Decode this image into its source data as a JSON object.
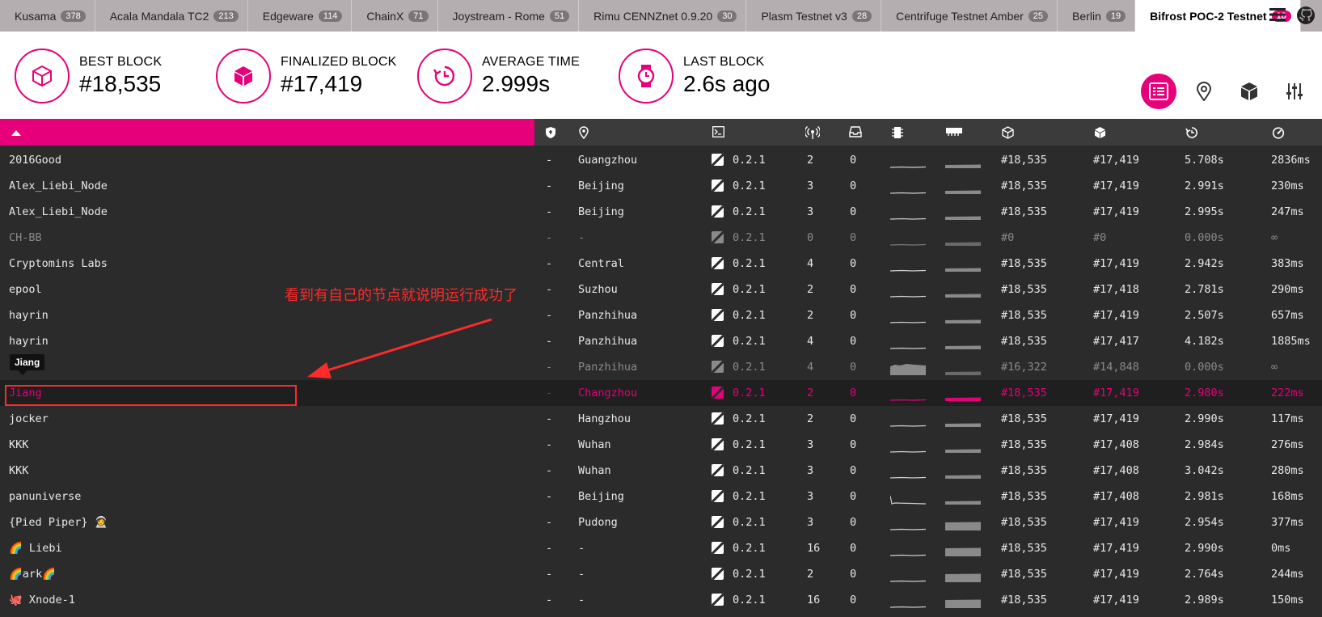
{
  "tabs": [
    {
      "name": "Kusama",
      "count": "378"
    },
    {
      "name": "Acala Mandala TC2",
      "count": "213"
    },
    {
      "name": "Edgeware",
      "count": "114"
    },
    {
      "name": "ChainX",
      "count": "71"
    },
    {
      "name": "Joystream - Rome",
      "count": "51"
    },
    {
      "name": "Rimu CENNZnet 0.9.20",
      "count": "30"
    },
    {
      "name": "Plasm Testnet v3",
      "count": "28"
    },
    {
      "name": "Centrifuge Testnet Amber",
      "count": "25"
    },
    {
      "name": "Berlin",
      "count": "19"
    },
    {
      "name": "Bifrost POC-2 Testnet",
      "count": "18"
    }
  ],
  "stats": {
    "best_block": {
      "label": "BEST BLOCK",
      "value": "#18,535"
    },
    "finalized_block": {
      "label": "FINALIZED BLOCK",
      "value": "#17,419"
    },
    "average_time": {
      "label": "AVERAGE TIME",
      "value": "2.999s"
    },
    "last_block": {
      "label": "LAST BLOCK",
      "value": "2.6s ago"
    }
  },
  "colors": {
    "accent": "#e6007a",
    "annotation": "#ff2a2a"
  },
  "icons": [
    "list-icon",
    "map-pin-icon",
    "cube-icon",
    "settings-sliders-icon",
    "menu-icon",
    "github-icon"
  ],
  "annotation": {
    "text": "看到有自己的节点就说明运行成功了",
    "tooltip": "Jiang"
  },
  "rows": [
    {
      "name": "2016Good",
      "validator": "-",
      "location": "Guangzhou",
      "version": "0.2.1",
      "peers": "2",
      "txs": "0",
      "best": "#18,535",
      "finalized": "#17,419",
      "time": "5.708s",
      "propagation": "2836ms",
      "state": "normal"
    },
    {
      "name": "Alex_Liebi_Node",
      "validator": "-",
      "location": "Beijing",
      "version": "0.2.1",
      "peers": "3",
      "txs": "0",
      "best": "#18,535",
      "finalized": "#17,419",
      "time": "2.991s",
      "propagation": "230ms",
      "state": "normal"
    },
    {
      "name": "Alex_Liebi_Node",
      "validator": "-",
      "location": "Beijing",
      "version": "0.2.1",
      "peers": "3",
      "txs": "0",
      "best": "#18,535",
      "finalized": "#17,419",
      "time": "2.995s",
      "propagation": "247ms",
      "state": "normal"
    },
    {
      "name": "CH-BB",
      "validator": "-",
      "location": "-",
      "version": "0.2.1",
      "peers": "0",
      "txs": "0",
      "best": "#0",
      "finalized": "#0",
      "time": "0.000s",
      "propagation": "∞",
      "state": "stale"
    },
    {
      "name": "Cryptomins Labs",
      "validator": "-",
      "location": "Central",
      "version": "0.2.1",
      "peers": "4",
      "txs": "0",
      "best": "#18,535",
      "finalized": "#17,419",
      "time": "2.942s",
      "propagation": "383ms",
      "state": "normal"
    },
    {
      "name": "epool",
      "validator": "-",
      "location": "Suzhou",
      "version": "0.2.1",
      "peers": "2",
      "txs": "0",
      "best": "#18,535",
      "finalized": "#17,418",
      "time": "2.781s",
      "propagation": "290ms",
      "state": "normal"
    },
    {
      "name": "hayrin",
      "validator": "-",
      "location": "Panzhihua",
      "version": "0.2.1",
      "peers": "2",
      "txs": "0",
      "best": "#18,535",
      "finalized": "#17,419",
      "time": "2.507s",
      "propagation": "657ms",
      "state": "normal"
    },
    {
      "name": "hayrin",
      "validator": "-",
      "location": "Panzhihua",
      "version": "0.2.1",
      "peers": "4",
      "txs": "0",
      "best": "#18,535",
      "finalized": "#17,417",
      "time": "4.182s",
      "propagation": "1885ms",
      "state": "normal"
    },
    {
      "name": "",
      "validator": "-",
      "location": "Panzhihua",
      "version": "0.2.1",
      "peers": "4",
      "txs": "0",
      "best": "#16,322",
      "finalized": "#14,848",
      "time": "0.000s",
      "propagation": "∞",
      "state": "stale"
    },
    {
      "name": "Jiang",
      "validator": "-",
      "location": "Changzhou",
      "version": "0.2.1",
      "peers": "2",
      "txs": "0",
      "best": "#18,535",
      "finalized": "#17,419",
      "time": "2.980s",
      "propagation": "222ms",
      "state": "highlight"
    },
    {
      "name": "jocker",
      "validator": "-",
      "location": "Hangzhou",
      "version": "0.2.1",
      "peers": "2",
      "txs": "0",
      "best": "#18,535",
      "finalized": "#17,419",
      "time": "2.990s",
      "propagation": "117ms",
      "state": "normal"
    },
    {
      "name": "KKK",
      "validator": "-",
      "location": "Wuhan",
      "version": "0.2.1",
      "peers": "3",
      "txs": "0",
      "best": "#18,535",
      "finalized": "#17,408",
      "time": "2.984s",
      "propagation": "276ms",
      "state": "normal"
    },
    {
      "name": "KKK",
      "validator": "-",
      "location": "Wuhan",
      "version": "0.2.1",
      "peers": "3",
      "txs": "0",
      "best": "#18,535",
      "finalized": "#17,408",
      "time": "3.042s",
      "propagation": "280ms",
      "state": "normal"
    },
    {
      "name": "panuniverse",
      "validator": "-",
      "location": "Beijing",
      "version": "0.2.1",
      "peers": "3",
      "txs": "0",
      "best": "#18,535",
      "finalized": "#17,408",
      "time": "2.981s",
      "propagation": "168ms",
      "state": "normal"
    },
    {
      "name": "{Pied Piper} 🧑‍🚀",
      "validator": "-",
      "location": "Pudong",
      "version": "0.2.1",
      "peers": "3",
      "txs": "0",
      "best": "#18,535",
      "finalized": "#17,419",
      "time": "2.954s",
      "propagation": "377ms",
      "state": "normal"
    },
    {
      "name": "🌈 Liebi",
      "validator": "-",
      "location": "-",
      "version": "0.2.1",
      "peers": "16",
      "txs": "0",
      "best": "#18,535",
      "finalized": "#17,419",
      "time": "2.990s",
      "propagation": "0ms",
      "state": "normal"
    },
    {
      "name": "🌈ark🌈",
      "validator": "-",
      "location": "-",
      "version": "0.2.1",
      "peers": "2",
      "txs": "0",
      "best": "#18,535",
      "finalized": "#17,419",
      "time": "2.764s",
      "propagation": "244ms",
      "state": "normal"
    },
    {
      "name": "🐙 Xnode-1",
      "validator": "-",
      "location": "-",
      "version": "0.2.1",
      "peers": "16",
      "txs": "0",
      "best": "#18,535",
      "finalized": "#17,419",
      "time": "2.989s",
      "propagation": "150ms",
      "state": "normal"
    }
  ]
}
